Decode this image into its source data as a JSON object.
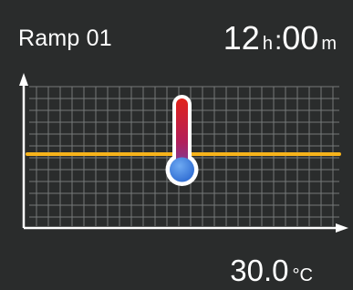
{
  "header": {
    "program_name": "Ramp 01",
    "time_hours": "12",
    "hours_unit": "h",
    "separator": ":",
    "time_minutes": "00",
    "minutes_unit": "m"
  },
  "graph": {
    "setpoint_line_color": "#f6b21b",
    "axis_color": "#ffffff",
    "grid_color": "#8e9393",
    "thermometer_icon": "thermometer-icon",
    "thermometer_fill_level": 0.86,
    "thermometer_colors": {
      "top": "#e2231a",
      "bottom": "#3a7fe0"
    }
  },
  "footer": {
    "temperature_int": "30",
    "temperature_dec": ".0",
    "temperature_unit": "°C"
  }
}
